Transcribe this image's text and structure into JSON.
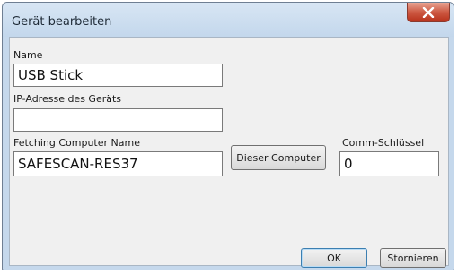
{
  "window": {
    "title": "Gerät bearbeiten"
  },
  "form": {
    "name_label": "Name",
    "name_value": "USB Stick",
    "ip_label": "IP-Adresse des Geräts",
    "ip_value": "",
    "fetching_label": "Fetching Computer Name",
    "fetching_value": "SAFESCAN-RES37",
    "this_computer_button": "Dieser Computer",
    "comm_key_label": "Comm-Schlüssel",
    "comm_key_value": "0"
  },
  "footer": {
    "ok_label": "OK",
    "cancel_label": "Stornieren"
  },
  "icons": {
    "close": "close-icon"
  },
  "colors": {
    "close_button": "#c8462d",
    "title_bar": "#c5d8ec",
    "client_background": "#f0f0f0"
  }
}
